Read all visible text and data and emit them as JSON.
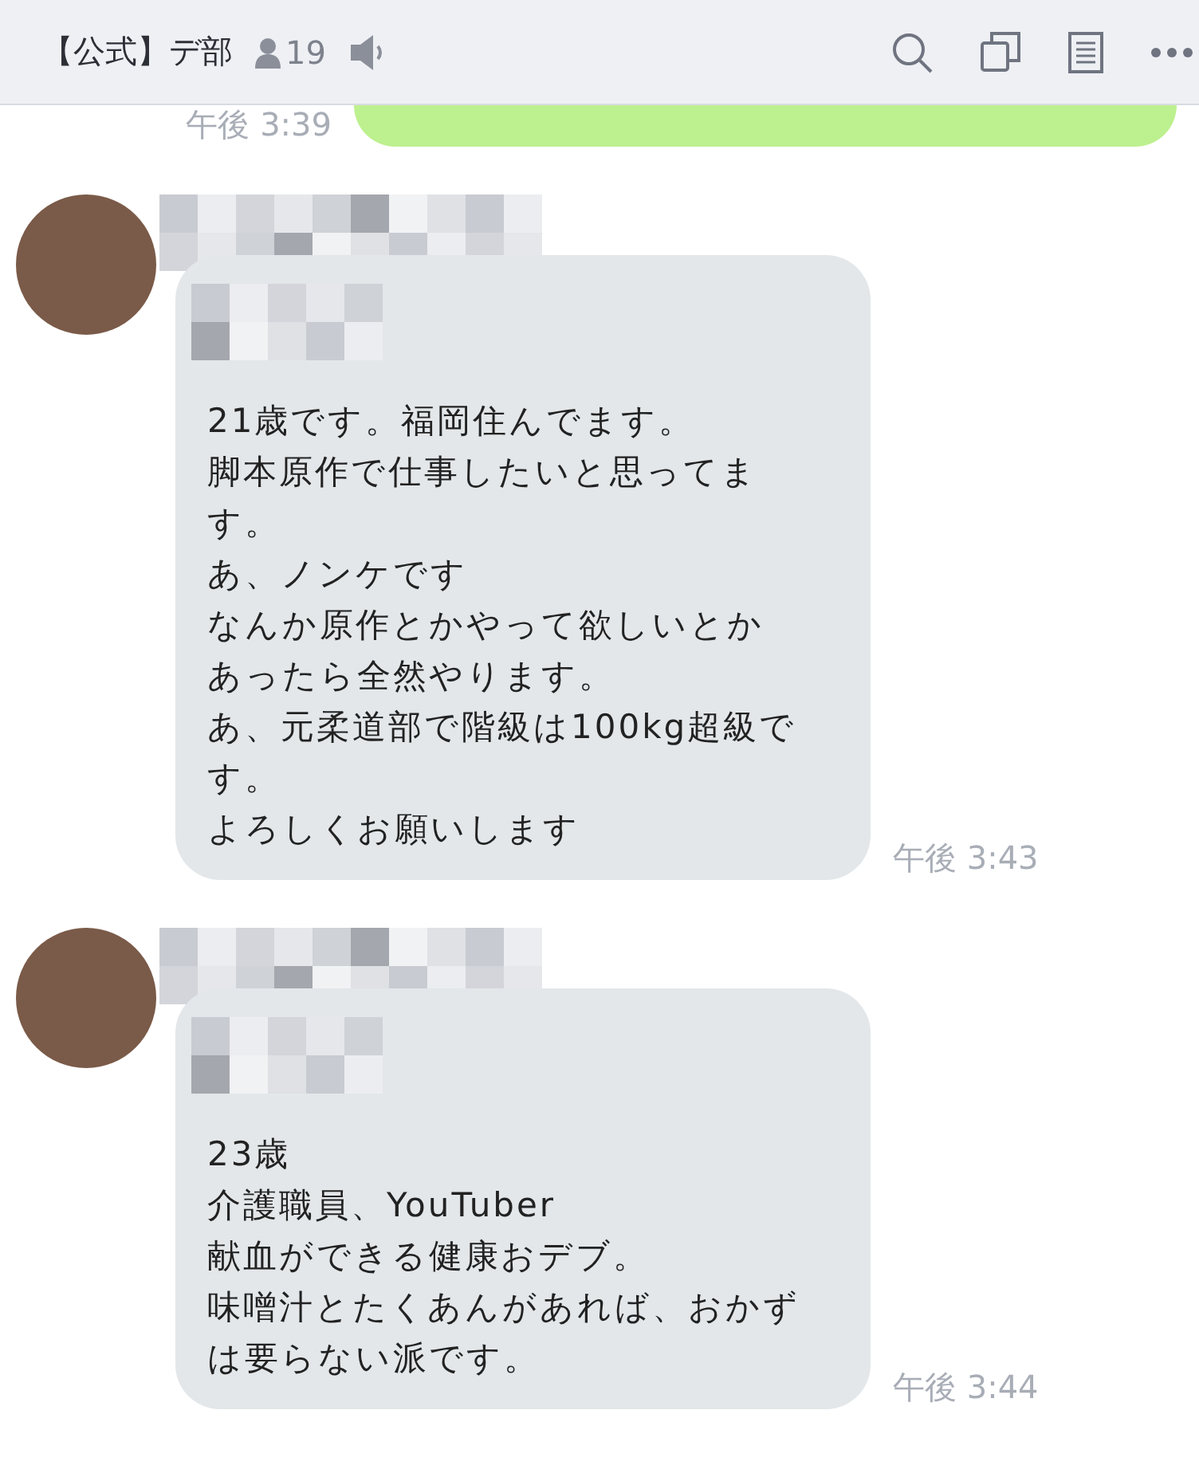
{
  "header": {
    "title": "【公式】デ部",
    "member_count": "19",
    "muted": false
  },
  "messages": [
    {
      "kind": "outgoing",
      "time": "午後 3:39"
    },
    {
      "kind": "incoming",
      "time": "午後 3:43",
      "lines": [
        "21歳です。福岡住んでます。",
        "脚本原作で仕事したいと思ってま",
        "す。",
        "あ、ノンケです",
        "なんか原作とかやって欲しいとか",
        "あったら全然やります。",
        "あ、元柔道部で階級は100kg超級で",
        "す。",
        "よろしくお願いします"
      ]
    },
    {
      "kind": "incoming",
      "time": "午後 3:44",
      "lines": [
        "23歳",
        "介護職員、YouTuber",
        "献血ができる健康おデブ。",
        "味噌汁とたくあんがあれば、おかず",
        "は要らない派です。"
      ]
    }
  ]
}
